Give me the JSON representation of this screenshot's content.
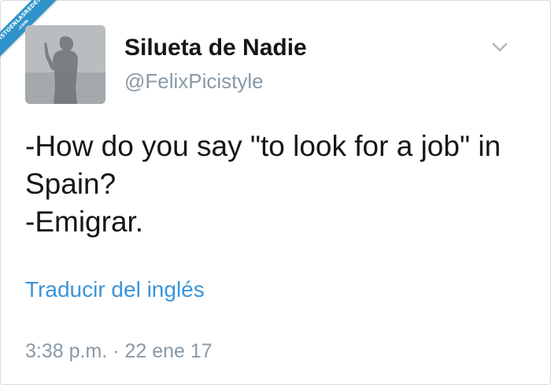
{
  "watermark": {
    "line1": "VISTOENLASREDES",
    "line2": ".com"
  },
  "tweet": {
    "display_name": "Silueta de Nadie",
    "handle": "@FelixPicistyle",
    "text_lines": [
      "-How do you say \"to look for a job\" in",
      "Spain?",
      "-Emigrar."
    ],
    "translate_link": "Traducir del inglés",
    "timestamp": "3:38 p.m. · 22 ene 17"
  },
  "icons": {
    "menu": "chevron-down-icon",
    "avatar": "silhouette-photo"
  },
  "colors": {
    "text": "#14171a",
    "secondary": "#8899a6",
    "link": "#3b94d9",
    "watermark": "#2f93c9"
  }
}
